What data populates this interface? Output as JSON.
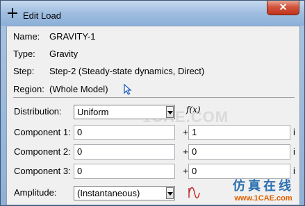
{
  "window": {
    "title": "Edit Load",
    "close_symbol": "✕"
  },
  "info": {
    "name_label": "Name:",
    "name_value": "GRAVITY-1",
    "type_label": "Type:",
    "type_value": "Gravity",
    "step_label": "Step:",
    "step_value": "Step-2 (Steady-state dynamics, Direct)",
    "region_label": "Region:",
    "region_value": "(Whole Model)",
    "region_icon": "cursor-arrow-icon"
  },
  "form": {
    "distribution": {
      "label": "Distribution:",
      "value": "Uniform",
      "fx": "f(x)"
    },
    "components": [
      {
        "label": "Component 1:",
        "real": "0",
        "plus": "+",
        "imag": "1",
        "i": "i"
      },
      {
        "label": "Component 2:",
        "real": "0",
        "plus": "+",
        "imag": "0",
        "i": "i"
      },
      {
        "label": "Component 3:",
        "real": "0",
        "plus": "+",
        "imag": "0",
        "i": "i"
      }
    ],
    "amplitude": {
      "label": "Amplitude:",
      "value": "(Instantaneous)",
      "icon": "amplitude-wave-icon"
    }
  },
  "watermark": "1CAE.COM",
  "brand": {
    "chinese": "仿真在线",
    "url": "www.1CAE.com"
  },
  "colors": {
    "title_bar": "#9fbde0",
    "close_button": "#c0321b",
    "brand_blue": "#2a6fb0",
    "brand_orange": "#e06000"
  }
}
